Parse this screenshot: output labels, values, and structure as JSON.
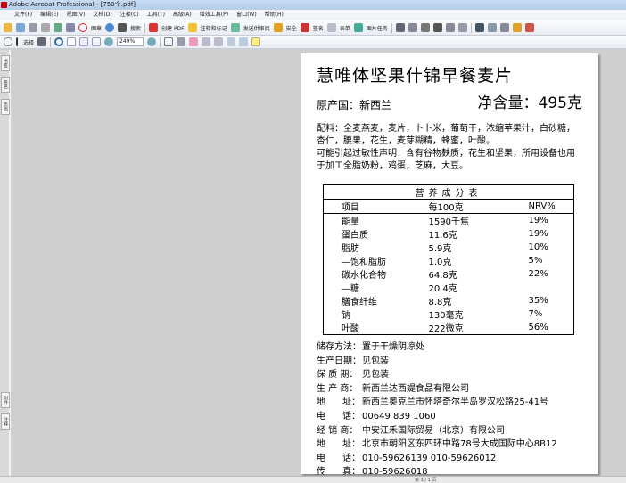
{
  "window": {
    "title": "Adobe Acrobat Professional - [750个.pdf]"
  },
  "menu": [
    "文件(F)",
    "编辑(E)",
    "视图(V)",
    "文档(D)",
    "注释(C)",
    "工具(T)",
    "高级(A)",
    "增效工具(P)",
    "窗口(W)",
    "帮助(H)"
  ],
  "toolbar": {
    "stamp": "图章",
    "search": "搜索",
    "create_pdf": "创建 PDF",
    "comment": "注释和标记",
    "review": "发送供审阅",
    "secure": "安全",
    "sign": "签名",
    "forms": "表单",
    "picture": "图片任务",
    "select": "选择",
    "zoom": "249%"
  },
  "sidebar": {
    "tabs": [
      "书签",
      "签名",
      "页面",
      "附件",
      "注释"
    ]
  },
  "doc": {
    "title": "慧唯体坚果什锦早餐麦片",
    "origin": "原产国：新西兰",
    "net": "净含量：495克",
    "ingredients": "配料：全麦燕麦，麦片，卜卜米，葡萄干，浓缩苹果汁，白砂糖，杏仁，腰果，花生，麦芽糊精，蜂蜜，叶酸。",
    "allergen": "可能引起过敏性声明：含有谷物麸质，花生和坚果，所用设备也用于加工全脂奶粉，鸡蛋，芝麻，大豆。",
    "table": {
      "title": "营养成分表",
      "headers": [
        "项目",
        "每100克",
        "NRV%"
      ],
      "rows": [
        [
          "能量",
          "1590千焦",
          "19%"
        ],
        [
          "蛋白质",
          "11.6克",
          "19%"
        ],
        [
          "脂肪",
          "5.9克",
          "10%"
        ],
        [
          "—饱和脂肪",
          "1.0克",
          "5%"
        ],
        [
          "碳水化合物",
          "64.8克",
          "22%"
        ],
        [
          "—糖",
          "20.4克",
          ""
        ],
        [
          "膳食纤维",
          "8.8克",
          "35%"
        ],
        [
          "钠",
          "130毫克",
          "7%"
        ],
        [
          "叶酸",
          "222微克",
          "56%"
        ]
      ]
    },
    "info": [
      [
        "储存方法：",
        "置于干燥阴凉处"
      ],
      [
        "生产日期：",
        "见包装"
      ],
      [
        "保 质 期：",
        "见包装"
      ],
      [
        "生 产 商：",
        "新西兰达西媞食品有限公司"
      ],
      [
        "地      址：",
        "新西兰奥克兰市怀塔奇尔半岛罗汉松路25-41号"
      ],
      [
        "电      话：",
        "00649 839 1060"
      ],
      [
        "经 销 商：",
        "中安江禾国际贸易（北京）有限公司"
      ],
      [
        "地      址：",
        "北京市朝阳区东四环中路78号大成国际中心8B12"
      ],
      [
        "电      话：",
        "010-59626139    010-59626012"
      ],
      [
        "传      真：",
        "010-59626018"
      ]
    ]
  },
  "status": {
    "page": "第 1 / 1 页"
  }
}
